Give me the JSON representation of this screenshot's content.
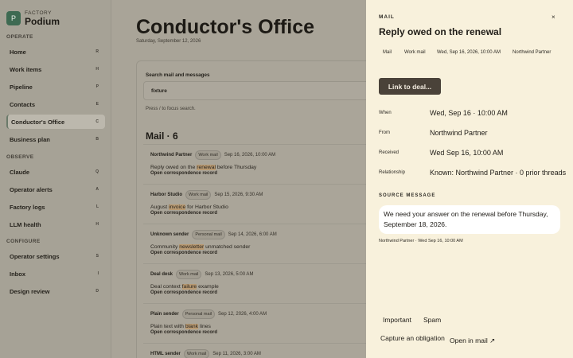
{
  "brand": {
    "kicker": "FACTORY",
    "name": "Podium",
    "logo_letter": "P"
  },
  "sidebar": {
    "sections": [
      "OPERATE",
      "OBSERVE",
      "CONFIGURE"
    ],
    "items": [
      {
        "label": "Home",
        "key": "R"
      },
      {
        "label": "Work items",
        "key": "H"
      },
      {
        "label": "Pipeline",
        "key": "P"
      },
      {
        "label": "Contacts",
        "key": "E"
      },
      {
        "label": "Conductor's Office",
        "key": "C"
      },
      {
        "label": "Business plan",
        "key": "B"
      },
      {
        "label": "Claude",
        "key": "Q"
      },
      {
        "label": "Operator alerts",
        "key": "A"
      },
      {
        "label": "Factory logs",
        "key": "L"
      },
      {
        "label": "LLM health",
        "key": "H"
      },
      {
        "label": "Operator settings",
        "key": "S"
      },
      {
        "label": "Inbox",
        "key": "I"
      },
      {
        "label": "Design review",
        "key": "D"
      }
    ]
  },
  "main": {
    "title": "Conductor's Office",
    "date": "Saturday, September 12, 2026",
    "search_label": "Search mail and messages",
    "search_value": "fixture",
    "search_hint": "Press / to focus search.",
    "mail_heading": "Mail · 6",
    "open_record": "Open correspondence record",
    "mails": [
      {
        "sender": "Northwind Partner",
        "tag": "Work mail",
        "date": "Sep 16, 2026, 10:00 AM",
        "pre": "Reply owed on the ",
        "hl": "renewal",
        "post": " before Thursday"
      },
      {
        "sender": "Harbor Studio",
        "tag": "Work mail",
        "date": "Sep 15, 2026, 9:30 AM",
        "pre": "August ",
        "hl": "invoice",
        "post": " for Harbor Studio"
      },
      {
        "sender": "Unknown sender",
        "tag": "Personal mail",
        "date": "Sep 14, 2026, 6:00 AM",
        "pre": "Community ",
        "hl": "newsletter",
        "post": " unmatched sender"
      },
      {
        "sender": "Deal desk",
        "tag": "Work mail",
        "date": "Sep 13, 2026, 5:00 AM",
        "pre": "Deal context ",
        "hl": "failure",
        "post": " example"
      },
      {
        "sender": "Plain sender",
        "tag": "Personal mail",
        "date": "Sep 12, 2026, 4:00 AM",
        "pre": "Plain text with ",
        "hl": "blank",
        "post": " lines"
      },
      {
        "sender": "HTML sender",
        "tag": "Work mail",
        "date": "Sep 11, 2026, 3:00 AM",
        "pre": "",
        "hl": "",
        "post": ""
      }
    ]
  },
  "drawer": {
    "kicker": "MAIL",
    "close_glyph": "×",
    "title": "Reply owed on the renewal",
    "meta": [
      "Mail",
      "Work mail",
      "Wed, Sep 16, 2026, 10:00 AM",
      "Northwind Partner"
    ],
    "link_button": "Link to deal...",
    "details": [
      {
        "label": "When",
        "value": "Wed, Sep 16 · 10:00 AM"
      },
      {
        "label": "From",
        "value": "Northwind Partner"
      },
      {
        "label": "Received",
        "value": "Wed Sep 16, 10:00 AM"
      },
      {
        "label": "Relationship",
        "value": "Known: Northwind Partner · 0 prior threads"
      }
    ],
    "source_kicker": "SOURCE MESSAGE",
    "source_text": "We need your answer on the renewal before Thursday, September 18, 2026.",
    "source_footer": "Northwind Partner · Wed Sep 16, 10:00 AM",
    "actions": {
      "important": "Important",
      "spam": "Spam",
      "capture": "Capture an obligation",
      "open_in_mail": "Open in mail ↗"
    }
  },
  "colors": {
    "accent_green": "#3e6a52",
    "drawer_bg": "#f8f1dc",
    "button_dark": "#4a4239",
    "highlight": "#b99a72"
  }
}
